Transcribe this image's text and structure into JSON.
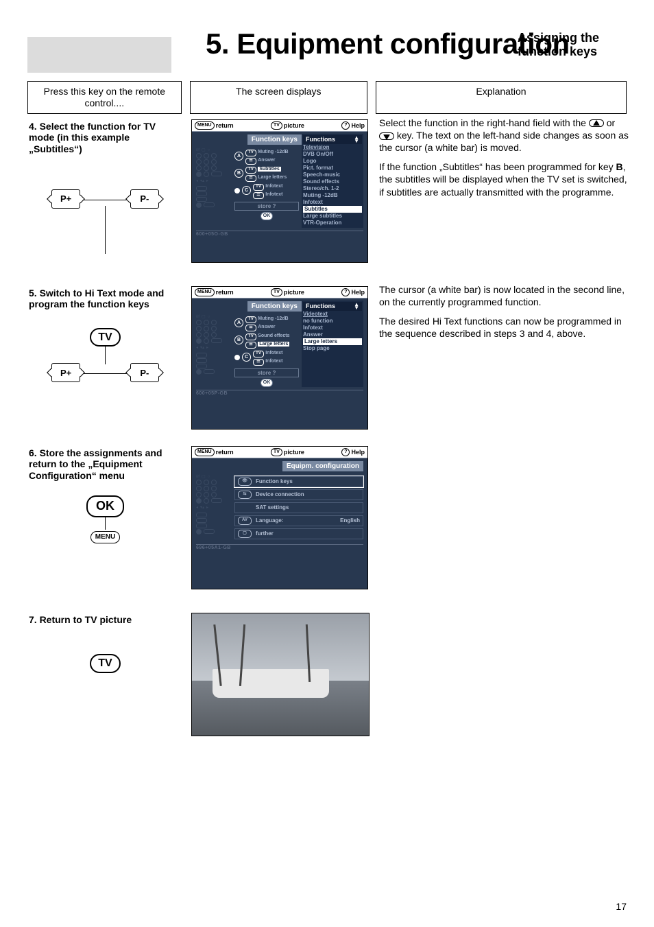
{
  "header": {
    "chapter": "5. Equipment configuration",
    "subtitle_line1": "Assigning the",
    "subtitle_line2": "function keys"
  },
  "column_headers": {
    "left": "Press this key on the remote control....",
    "middle": "The screen displays",
    "right": "Explanation"
  },
  "remote_btn": {
    "p_plus": "P+",
    "p_minus": "P-",
    "tv": "TV",
    "ok": "OK",
    "menu": "MENU"
  },
  "tv_bar": {
    "return_icon": "MENU",
    "return": "return",
    "picture_icon": "TV",
    "picture": "picture",
    "help_icon": "?",
    "help": "Help",
    "ok_icon": "OK"
  },
  "step4": {
    "title": "4. Select the function for TV mode (in this example „Subtitles“)",
    "panel_title": "Function keys",
    "functions_head": "Functions",
    "functions": [
      "Television",
      "DVB On/Off",
      "Logo",
      "Pict. format",
      "Speech-music",
      "Sound effects",
      "Stereo/ch. 1-2",
      "Muting -12dB",
      "Infotext",
      "Subtitles",
      "Large subtitles",
      "VTR-Operation"
    ],
    "selected_idx": 9,
    "rowA": {
      "top": "Muting -12dB",
      "bottom": "Answer",
      "letter": "A",
      "top_icon": "TV",
      "bot_icon": "☰"
    },
    "rowB": {
      "top": "Subtitles",
      "bottom": "Large letters",
      "letter": "B",
      "top_icon": "TV",
      "bot_icon": "☰",
      "top_selected": true
    },
    "rowC": {
      "top": "Infotext",
      "bottom": "Infotext",
      "letter": "C",
      "top_icon": "TV",
      "bot_icon": "☰"
    },
    "store": "store ?",
    "code": "600+05O-GB",
    "explanation_p1a": "Select the function in the right-hand field with the ",
    "explanation_p1b": " or ",
    "explanation_p1c": " key. The text on the left-hand side changes as soon as the cursor (a white bar) is moved.",
    "explanation_p2a": "If the function „Subtitles“ has been programmed for key ",
    "explanation_p2b": "B",
    "explanation_p2c": ", the subtitles will be displayed when the TV set is switched, if subtitles are actually transmitted with the programme."
  },
  "step5": {
    "title": "5. Switch to Hi Text mode and program the function keys",
    "panel_title": "Function keys",
    "functions_head": "Functions",
    "functions": [
      "Videotext",
      "no function",
      "Infotext",
      "Answer",
      "Large letters",
      "Stop page"
    ],
    "selected_idx": 4,
    "rowA": {
      "top": "Muting -12dB",
      "bottom": "Answer",
      "letter": "A",
      "top_icon": "TV",
      "bot_icon": "☰"
    },
    "rowB": {
      "top": "Sound effects",
      "bottom": "Large letters",
      "letter": "B",
      "top_icon": "TV",
      "bot_icon": "☰",
      "bottom_selected": true
    },
    "rowC": {
      "top": "Infotext",
      "bottom": "Infotext",
      "letter": "C",
      "top_icon": "TV",
      "bot_icon": "☰"
    },
    "store": "store ?",
    "code": "600+05P-GB",
    "explanation_p1": "The cursor (a white bar) is now located in the second line, on the currently programmed function.",
    "explanation_p2": "The desired Hi Text functions can now be programmed in the sequence described in steps 3 and 4, above."
  },
  "step6": {
    "title": "6. Store the assignments and return to the „Equipment Configuration“ menu",
    "panel_title": "Equipm. configuration",
    "rows": [
      {
        "icon": "👁",
        "label": "Function keys",
        "value": "",
        "selected": true
      },
      {
        "icon": "⇆",
        "label": "Device connection",
        "value": ""
      },
      {
        "icon": "",
        "label": "SAT settings",
        "value": ""
      },
      {
        "icon": "AV",
        "label": "Language:",
        "value": "English"
      },
      {
        "icon": "▢",
        "label": "further",
        "value": ""
      }
    ],
    "code": "696+05A1-GB"
  },
  "step7": {
    "title": "7. Return to TV picture"
  },
  "page_number": "17"
}
